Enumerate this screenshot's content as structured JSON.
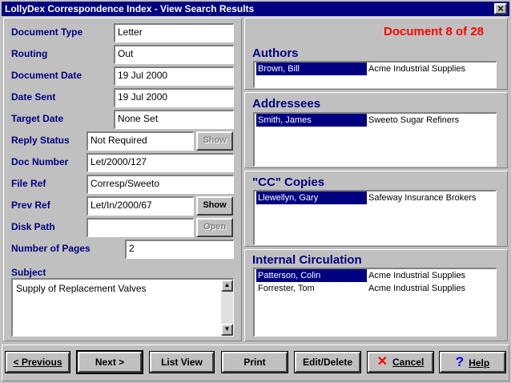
{
  "window": {
    "title": "LollyDex Correspondence Index - View Search Results",
    "close_glyph": "×"
  },
  "doc_counter": "Document 8 of 28",
  "fields": {
    "document_type": {
      "label": "Document Type",
      "value": "Letter"
    },
    "routing": {
      "label": "Routing",
      "value": "Out"
    },
    "document_date": {
      "label": "Document Date",
      "value": "19 Jul 2000"
    },
    "date_sent": {
      "label": "Date Sent",
      "value": "19 Jul 2000"
    },
    "target_date": {
      "label": "Target Date",
      "value": "None Set"
    },
    "reply_status": {
      "label": "Reply Status",
      "value": "Not Required",
      "button": "Show"
    },
    "doc_number": {
      "label": "Doc Number",
      "value": "Let/2000/127"
    },
    "file_ref": {
      "label": "File Ref",
      "value": "Corresp/Sweeto"
    },
    "prev_ref": {
      "label": "Prev Ref",
      "value": "Let/In/2000/67",
      "button": "Show"
    },
    "disk_path": {
      "label": "Disk Path",
      "value": "",
      "button": "Open"
    },
    "number_of_pages": {
      "label": "Number of Pages",
      "value": "2"
    },
    "subject": {
      "label": "Subject",
      "value": "Supply of Replacement Valves"
    }
  },
  "sections": {
    "authors": {
      "title": "Authors",
      "rows": [
        {
          "name": "Brown, Bill",
          "company": "Acme Industrial Supplies"
        }
      ]
    },
    "addressees": {
      "title": "Addressees",
      "rows": [
        {
          "name": "Smith, James",
          "company": "Sweeto Sugar Refiners"
        }
      ]
    },
    "cc": {
      "title": "\"CC\" Copies",
      "rows": [
        {
          "name": "Llewellyn, Gary",
          "company": "Safeway Insurance Brokers"
        }
      ]
    },
    "internal": {
      "title": "Internal  Circulation",
      "rows": [
        {
          "name": "Patterson, Colin",
          "company": "Acme Industrial Supplies"
        },
        {
          "name": "Forrester, Tom",
          "company": "Acme Industrial Supplies"
        }
      ]
    }
  },
  "buttons": {
    "previous": "< Previous",
    "next": "Next  >",
    "list_view": "List View",
    "print": "Print",
    "edit_delete": "Edit/Delete",
    "cancel": "Cancel",
    "help": "Help"
  },
  "colors": {
    "accent": "#000080",
    "counter": "#ff0000",
    "cancel_icon": "#ff0000",
    "help_icon": "#0000ff"
  }
}
